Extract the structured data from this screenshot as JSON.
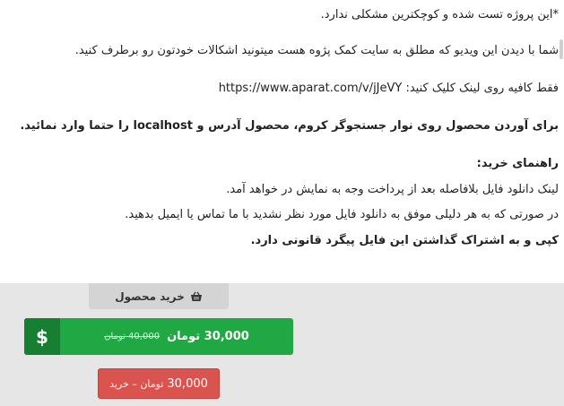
{
  "article": {
    "line1": "*این پروژه تست شده و کوچکترین مشکلی ندارد.",
    "line2": "شما با دیدن این ویدیو که مطلق به سایت کمک پژوه هست میتونید اشکالات خودتون رو برطرف کنید.",
    "line3": "فقط کافیه روی لینک کلیک کنید:  https://www.aparat.com/v/jJeVY",
    "line4": "برای آوردن محصول روی نوار جستجوگر کروم، محصول آدرس و localhost را حتما وارد نمائید.",
    "line5": "راهنمای خرید:",
    "line6": "لینک دانلود فایل بلافاصله بعد از پرداخت وجه به نمایش در خواهد آمد.",
    "line7": "در صورتی که به هر دلیلی موفق به دانلود فایل مورد نظر نشدید با ما تماس یا ایمیل بدهید.",
    "line8": "کپی و به اشتراک گذاشتن این فایل پیگرد قانونی دارد."
  },
  "product": {
    "basket_label": "خرید محصول",
    "basket_icon": "basket-icon",
    "dollar_glyph": "$",
    "price_amount": "30,000",
    "price_unit": "تومان",
    "old_price": "40,000 تومان",
    "buy_amount": "30,000",
    "buy_unit": "تومان – خرید"
  },
  "colors": {
    "price_green": "#1fa843",
    "dollar_dark_green": "#167f32",
    "buy_red": "#d9534f",
    "grey_panel": "#e6e6e6"
  }
}
